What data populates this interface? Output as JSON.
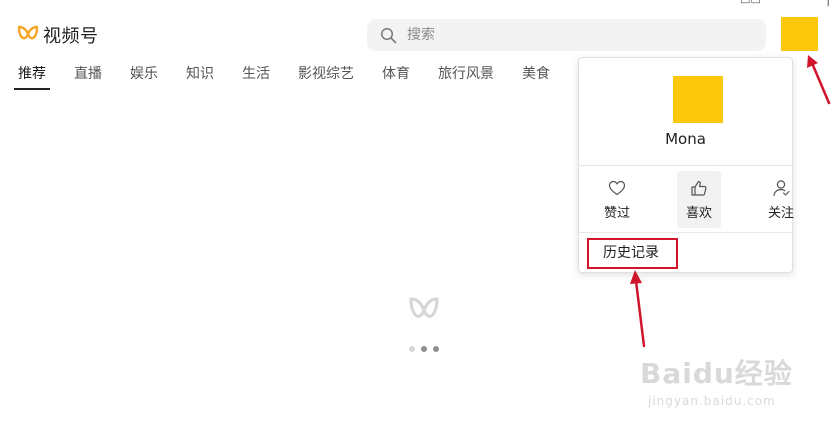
{
  "app": {
    "logo_text": "视频号"
  },
  "search": {
    "placeholder": "搜索"
  },
  "nav": {
    "tabs": [
      "推荐",
      "直播",
      "娱乐",
      "知识",
      "生活",
      "影视综艺",
      "体育",
      "旅行风景",
      "美食"
    ],
    "active_index": 0
  },
  "user_menu": {
    "username": "Mona",
    "actions": [
      {
        "label": "赞过",
        "icon": "heart-icon"
      },
      {
        "label": "喜欢",
        "icon": "thumbs-up-icon"
      },
      {
        "label": "关注",
        "icon": "follow-user-icon"
      }
    ],
    "history_label": "历史记录"
  },
  "top_edge_glyphs": [
    "▭▭",
    "⎸"
  ],
  "watermark": {
    "brand": "Baidu经验",
    "url": "jingyan.baidu.com"
  },
  "colors": {
    "avatar": "#fdc70c",
    "logo": "#f5a623",
    "annotation": "#d0152b",
    "active_tab_underline": "#222222"
  }
}
